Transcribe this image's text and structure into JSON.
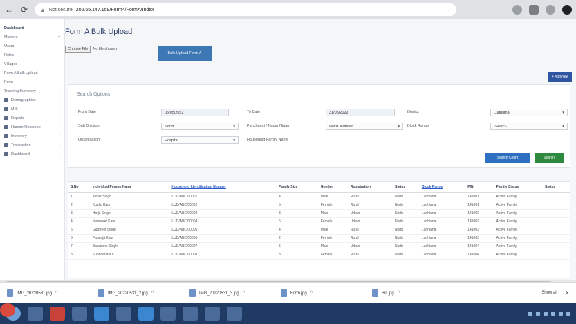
{
  "browser": {
    "security_label": "Not secure",
    "url": "202.65.147.159/Form4/FormA/Index",
    "url_host_path": "202.65.147.159/Form4/FormA/Index"
  },
  "sidebar": {
    "items": [
      {
        "label": "Dashboard"
      },
      {
        "label": "Masters"
      },
      {
        "label": "Users"
      },
      {
        "label": "Roles"
      },
      {
        "label": "Villages"
      },
      {
        "label": "Form A Bulk Upload"
      },
      {
        "label": "Form"
      },
      {
        "label": "Tracking Summary"
      },
      {
        "label": "Demographics"
      },
      {
        "label": "MIS"
      },
      {
        "label": "Reports"
      },
      {
        "label": "Human Resource"
      },
      {
        "label": "Inventory"
      },
      {
        "label": "Transaction"
      },
      {
        "label": "Dashboard"
      }
    ]
  },
  "page": {
    "title": "Form A Bulk Upload",
    "choose_file_label": "Choose File",
    "no_file_label": "No file chosen",
    "upload_button": "Bulk Upload Form A",
    "add_button": "+ Add New"
  },
  "filters": {
    "title": "Search Options",
    "from_date_label": "From Date",
    "from_date_value": "06/05/2022",
    "to_date_label": "To Date",
    "to_date_value": "31/05/2022",
    "district_label": "District",
    "district_value": "Ludhiana",
    "sub_division_label": "Sub Division",
    "sub_division_value": "Ludhiana",
    "area_label": "Area",
    "area_value": "North",
    "panchayat_label": "Panchayat / Nagar Nigam",
    "panchayat_value": "Ward Number",
    "block_label": "Block Range",
    "block_value": "-Select-",
    "organisation_label": "Organisation",
    "organisation_value": "Hospital",
    "family_label": "Household Family Name",
    "search_count_button": "Search Count",
    "search_button": "Search"
  },
  "table": {
    "headers": [
      "S.No",
      "Individual Person Name",
      "Household Identification Number",
      "Family Size",
      "Gender",
      "Registration",
      "Status",
      "Block Range",
      "PIN",
      "Family Status",
      "Status"
    ],
    "rows": [
      [
        "1",
        "Jasvir Singh",
        "LUD/ABC/00001",
        "4",
        "Male",
        "Rural",
        "North",
        "Ludhiana",
        "141001",
        "Active Family",
        ""
      ],
      [
        "2",
        "Kuldip Kaur",
        "LUD/ABC/00002",
        "5",
        "Female",
        "Rural",
        "North",
        "Ludhiana",
        "141001",
        "Active Family",
        ""
      ],
      [
        "3",
        "Harjit Singh",
        "LUD/ABC/00003",
        "3",
        "Male",
        "Urban",
        "North",
        "Ludhiana",
        "141002",
        "Active Family",
        ""
      ],
      [
        "4",
        "Manpreet Kaur",
        "LUD/ABC/00004",
        "6",
        "Female",
        "Urban",
        "North",
        "Ludhiana",
        "141002",
        "Active Family",
        ""
      ],
      [
        "5",
        "Gurpreet Singh",
        "LUD/ABC/00005",
        "4",
        "Male",
        "Rural",
        "North",
        "Ludhiana",
        "141003",
        "Active Family",
        ""
      ],
      [
        "6",
        "Paramjit Kaur",
        "LUD/ABC/00006",
        "2",
        "Female",
        "Rural",
        "North",
        "Ludhiana",
        "141003",
        "Active Family",
        ""
      ],
      [
        "7",
        "Balwinder Singh",
        "LUD/ABC/00007",
        "5",
        "Male",
        "Urban",
        "North",
        "Ludhiana",
        "141004",
        "Active Family",
        ""
      ],
      [
        "8",
        "Surinder Kaur",
        "LUD/ABC/00008",
        "3",
        "Female",
        "Rural",
        "North",
        "Ludhiana",
        "141004",
        "Active Family",
        ""
      ]
    ]
  },
  "downloads": {
    "items": [
      {
        "name": "IMG_20220531.jpg"
      },
      {
        "name": "IMG_20220531_2.jpg"
      },
      {
        "name": "IMG_20220531_3.jpg"
      },
      {
        "name": "Form.jpg"
      },
      {
        "name": "Bill.jpg"
      }
    ],
    "show_all": "Show all"
  }
}
